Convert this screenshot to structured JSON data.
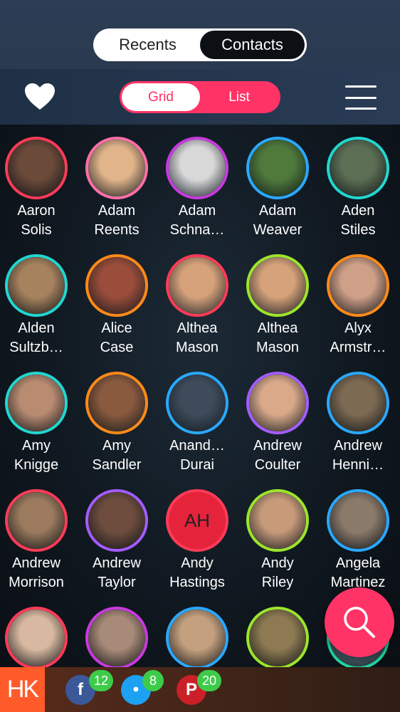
{
  "header": {
    "tabs": [
      {
        "label": "Recents",
        "active": false
      },
      {
        "label": "Contacts",
        "active": true
      }
    ]
  },
  "view_toggle": {
    "options": [
      {
        "label": "Grid",
        "active": true
      },
      {
        "label": "List",
        "active": false
      }
    ]
  },
  "colors": {
    "accent": "#ff3366",
    "header_bg": "#2c3d55",
    "bottom_bar": "#4a2818",
    "badge": "#3ecb4a",
    "logo_bg": "#ff5a2a"
  },
  "contacts": [
    {
      "first": "Aaron",
      "last": "Solis",
      "ring": "#ff3b58",
      "photo": "#6b4a3a"
    },
    {
      "first": "Adam",
      "last": "Reents",
      "ring": "#ff6fa8",
      "photo": "#e1b48a"
    },
    {
      "first": "Adam",
      "last": "Schna…",
      "ring": "#c83adf",
      "photo": "#d8d8d8"
    },
    {
      "first": "Adam",
      "last": "Weaver",
      "ring": "#2aa8ff",
      "photo": "#4f7a3c"
    },
    {
      "first": "Aden",
      "last": "Stiles",
      "ring": "#22d6d0",
      "photo": "#5c6f55"
    },
    {
      "first": "Alden",
      "last": "Sultzb…",
      "ring": "#22d6d0",
      "photo": "#a7825e"
    },
    {
      "first": "Alice",
      "last": "Case",
      "ring": "#ff8a1a",
      "photo": "#9a4d3a"
    },
    {
      "first": "Althea",
      "last": "Mason",
      "ring": "#ff3b58",
      "photo": "#d6a27a"
    },
    {
      "first": "Althea",
      "last": "Mason",
      "ring": "#9be52b",
      "photo": "#d6a27a"
    },
    {
      "first": "Alyx",
      "last": "Armstr…",
      "ring": "#ff8a1a",
      "photo": "#cfa088"
    },
    {
      "first": "Amy",
      "last": "Knigge",
      "ring": "#22d6d0",
      "photo": "#b98c72"
    },
    {
      "first": "Amy",
      "last": "Sandler",
      "ring": "#ff8a1a",
      "photo": "#8a5a3e"
    },
    {
      "first": "Anand…",
      "last": "Durai",
      "ring": "#2aa8ff",
      "photo": "#3d4b5a"
    },
    {
      "first": "Andrew",
      "last": "Coulter",
      "ring": "#a45cff",
      "photo": "#d9a98a"
    },
    {
      "first": "Andrew",
      "last": "Henni…",
      "ring": "#2aa8ff",
      "photo": "#7d6a52"
    },
    {
      "first": "Andrew",
      "last": "Morrison",
      "ring": "#ff3b58",
      "photo": "#9b7a5e"
    },
    {
      "first": "Andrew",
      "last": "Taylor",
      "ring": "#a45cff",
      "photo": "#6e4d3e"
    },
    {
      "first": "Andy",
      "last": "Hastings",
      "ring": "#ff3b58",
      "photo": "#e5233a",
      "initials": "AH"
    },
    {
      "first": "Andy",
      "last": "Riley",
      "ring": "#9be52b",
      "photo": "#c79a7a"
    },
    {
      "first": "Angela",
      "last": "Martinez",
      "ring": "#2aa8ff",
      "photo": "#8a7a6a"
    },
    {
      "first": "",
      "last": "",
      "ring": "#ff3b58",
      "photo": "#d8b8a0"
    },
    {
      "first": "",
      "last": "",
      "ring": "#c83adf",
      "photo": "#a88a78"
    },
    {
      "first": "",
      "last": "",
      "ring": "#2aa8ff",
      "photo": "#c4a07e"
    },
    {
      "first": "",
      "last": "",
      "ring": "#9be52b",
      "photo": "#8d7a52"
    },
    {
      "first": "",
      "last": "",
      "ring": "#22d6a0",
      "photo": "#6a8a9a"
    }
  ],
  "bottom": {
    "logo": "HK",
    "social": [
      {
        "icon": "facebook-icon",
        "glyph": "f",
        "count": "12",
        "color": "#3b5998"
      },
      {
        "icon": "twitter-icon",
        "glyph": "•",
        "count": "8",
        "color": "#1da1f2"
      },
      {
        "icon": "pinterest-icon",
        "glyph": "P",
        "count": "20",
        "color": "#cb2027"
      }
    ]
  }
}
